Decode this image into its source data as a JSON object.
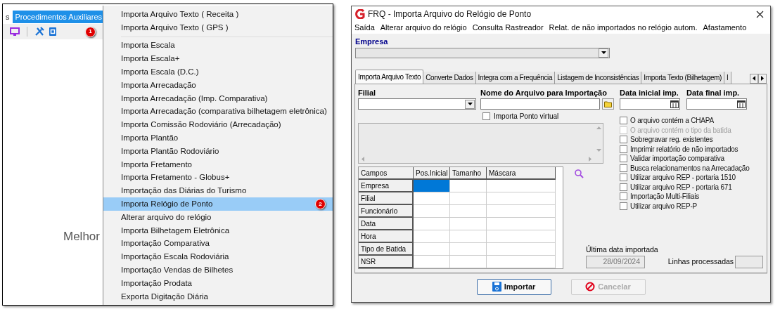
{
  "left_panel": {
    "menubar": [
      {
        "label": "s",
        "selected": false
      },
      {
        "label": "Procedimentos Auxiliares",
        "selected": true
      }
    ],
    "badge": "1",
    "background_text": "Melhor",
    "menu": {
      "groups": [
        [
          {
            "label": "Importa Arquivo Texto ( Receita )",
            "selected": false
          },
          {
            "label": "Importa Arquivo Texto ( GPS )",
            "selected": false
          }
        ],
        [
          {
            "label": "Importa Escala",
            "selected": false
          },
          {
            "label": "Importa Escala+",
            "selected": false
          },
          {
            "label": "Importa Escala (D.C.)",
            "selected": false
          },
          {
            "label": "Importa Arrecadação",
            "selected": false
          },
          {
            "label": "Importa Arrecadação (Imp. Comparativa)",
            "selected": false
          },
          {
            "label": "Importa Arrecadação (comparativa bilhetagem eletrônica)",
            "selected": false
          },
          {
            "label": "Importa Comissão Rodoviário (Arrecadação)",
            "selected": false
          },
          {
            "label": "Importa Plantão",
            "selected": false
          },
          {
            "label": "Importa Plantão Rodoviário",
            "selected": false
          },
          {
            "label": "Importa Fretamento",
            "selected": false
          },
          {
            "label": "Importa Fretamento - Globus+",
            "selected": false
          },
          {
            "label": "Importação das Diárias do Turismo",
            "selected": false
          },
          {
            "label": "Importa Relógio de Ponto",
            "selected": true,
            "badge": "2"
          },
          {
            "label": "Alterar arquivo do relógio",
            "selected": false
          },
          {
            "label": "Importa Bilhetagem Eletrônica",
            "selected": false
          },
          {
            "label": "Importação Comparativa",
            "selected": false
          },
          {
            "label": "Importação Escala Rodoviária",
            "selected": false
          },
          {
            "label": "Importação Vendas de Bilhetes",
            "selected": false
          },
          {
            "label": "Importação Prodata",
            "selected": false
          },
          {
            "label": "Exporta Digitação Diária",
            "selected": false
          }
        ]
      ]
    }
  },
  "window": {
    "title": "FRQ - Importa Arquivo do Relógio de Ponto",
    "menu": [
      "Saída",
      "Alterar arquivo do relógio",
      "Consulta Rastreador",
      "Relat. de não importados no relógio autom.",
      "Afastamento"
    ],
    "empresa": {
      "label": "Empresa"
    },
    "tabs": [
      {
        "label": "Importa Arquivo Texto",
        "selected": true
      },
      {
        "label": "Converte Dados",
        "selected": false
      },
      {
        "label": "Integra com a Frequência",
        "selected": false
      },
      {
        "label": "Listagem de Inconsistências",
        "selected": false
      },
      {
        "label": "Importa Texto (Bilhetagem)",
        "selected": false
      },
      {
        "label": "I",
        "selected": false
      }
    ],
    "filial": {
      "label": "Filial"
    },
    "arquivo": {
      "label": "Nome do Arquivo para Importação"
    },
    "ponto_virtual": {
      "label": "Importa Ponto virtual",
      "checked": false
    },
    "data_inicial": {
      "label": "Data inicial imp."
    },
    "data_final": {
      "label": "Data final imp."
    },
    "options": [
      {
        "label": "O arquivo contém a CHAPA",
        "checked": false,
        "disabled": false
      },
      {
        "label": "O arquivo contém o tipo da batida",
        "checked": false,
        "disabled": true
      },
      {
        "label": "Sobregravar reg. existentes",
        "checked": false,
        "disabled": false
      },
      {
        "label": "Imprimir relatório de não importados",
        "checked": false,
        "disabled": false
      },
      {
        "label": "Validar importação comparativa",
        "checked": false,
        "disabled": false
      },
      {
        "label": "Busca relacionamentos na Arrecadação",
        "checked": false,
        "disabled": false
      },
      {
        "label": "Utilizar arquivo REP - portaria 1510",
        "checked": false,
        "disabled": false
      },
      {
        "label": "Utilizar arquivo REP - portaria 671",
        "checked": false,
        "disabled": false
      },
      {
        "label": "Importação Multi-Filiais",
        "checked": false,
        "disabled": false
      },
      {
        "label": "Utilizar arquivo REP-P",
        "checked": false,
        "disabled": false
      }
    ],
    "grid": {
      "columns": [
        "Campos",
        "Pos.Inicial",
        "Tamanho",
        "Máscara"
      ],
      "rows": [
        {
          "label": "Empresa",
          "selected": true
        },
        {
          "label": "Filial",
          "selected": false
        },
        {
          "label": "Funcionário",
          "selected": false
        },
        {
          "label": "Data",
          "selected": false
        },
        {
          "label": "Hora",
          "selected": false
        },
        {
          "label": "Tipo de Batida",
          "selected": false
        },
        {
          "label": "NSR",
          "selected": false
        }
      ]
    },
    "ultima": {
      "label": "Última data importada",
      "value": "28/09/2024"
    },
    "linhas": {
      "label": "Linhas processadas"
    },
    "buttons": [
      {
        "kind": "save",
        "label": "Importar",
        "disabled": false
      },
      {
        "kind": "cancel",
        "label": "Cancelar",
        "disabled": true
      }
    ]
  }
}
